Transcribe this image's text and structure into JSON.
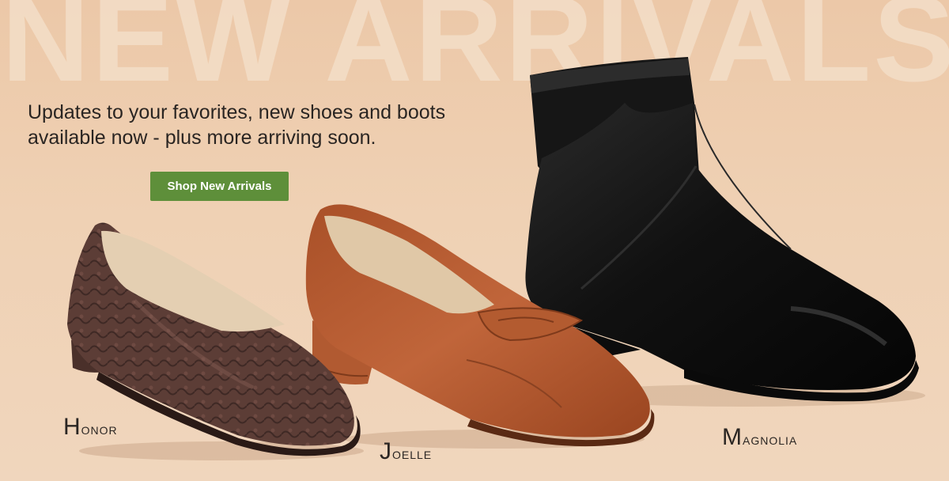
{
  "banner": {
    "headline": "NEW ARRIVALS",
    "tagline_line1": "Updates to your favorites, new shoes and boots",
    "tagline_line2": "available now - plus more arriving soon.",
    "cta_label": "Shop New Arrivals"
  },
  "products": [
    {
      "name": "Honor",
      "icon": "snakeskin-flat-shoe",
      "color": "#5a3a33"
    },
    {
      "name": "Joelle",
      "icon": "cognac-loafer-shoe",
      "color": "#b65a2f"
    },
    {
      "name": "Magnolia",
      "icon": "black-ankle-boot",
      "color": "#141414"
    }
  ],
  "colors": {
    "background": "#eecdb0",
    "headline": "#f3dcc5",
    "button": "#5e8f3a",
    "text": "#2a2522"
  }
}
